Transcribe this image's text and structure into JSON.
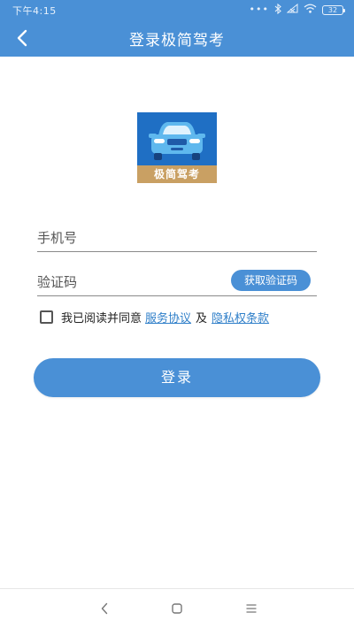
{
  "status_bar": {
    "time": "下午4:15",
    "dots": "•••",
    "battery": "32"
  },
  "title_bar": {
    "back_icon": "chevron-left-icon",
    "title": "登录极简驾考"
  },
  "logo": {
    "icon": "car-icon",
    "label": "极简驾考"
  },
  "form": {
    "phone_placeholder": "手机号",
    "code_placeholder": "验证码",
    "get_code_label": "获取验证码"
  },
  "agreement": {
    "text": "我已阅读并同意",
    "service_link": "服务协议",
    "and": "及",
    "privacy_link": "隐私权条款"
  },
  "login_label": "登录",
  "nav_bar": {
    "back_icon": "nav-back-icon",
    "home_icon": "nav-home-icon",
    "menu_icon": "nav-menu-icon"
  },
  "colors": {
    "primary": "#4a90d6",
    "link": "#2f7fc9",
    "logo_bg": "#1f6fc4",
    "logo_band": "#c9a063"
  }
}
